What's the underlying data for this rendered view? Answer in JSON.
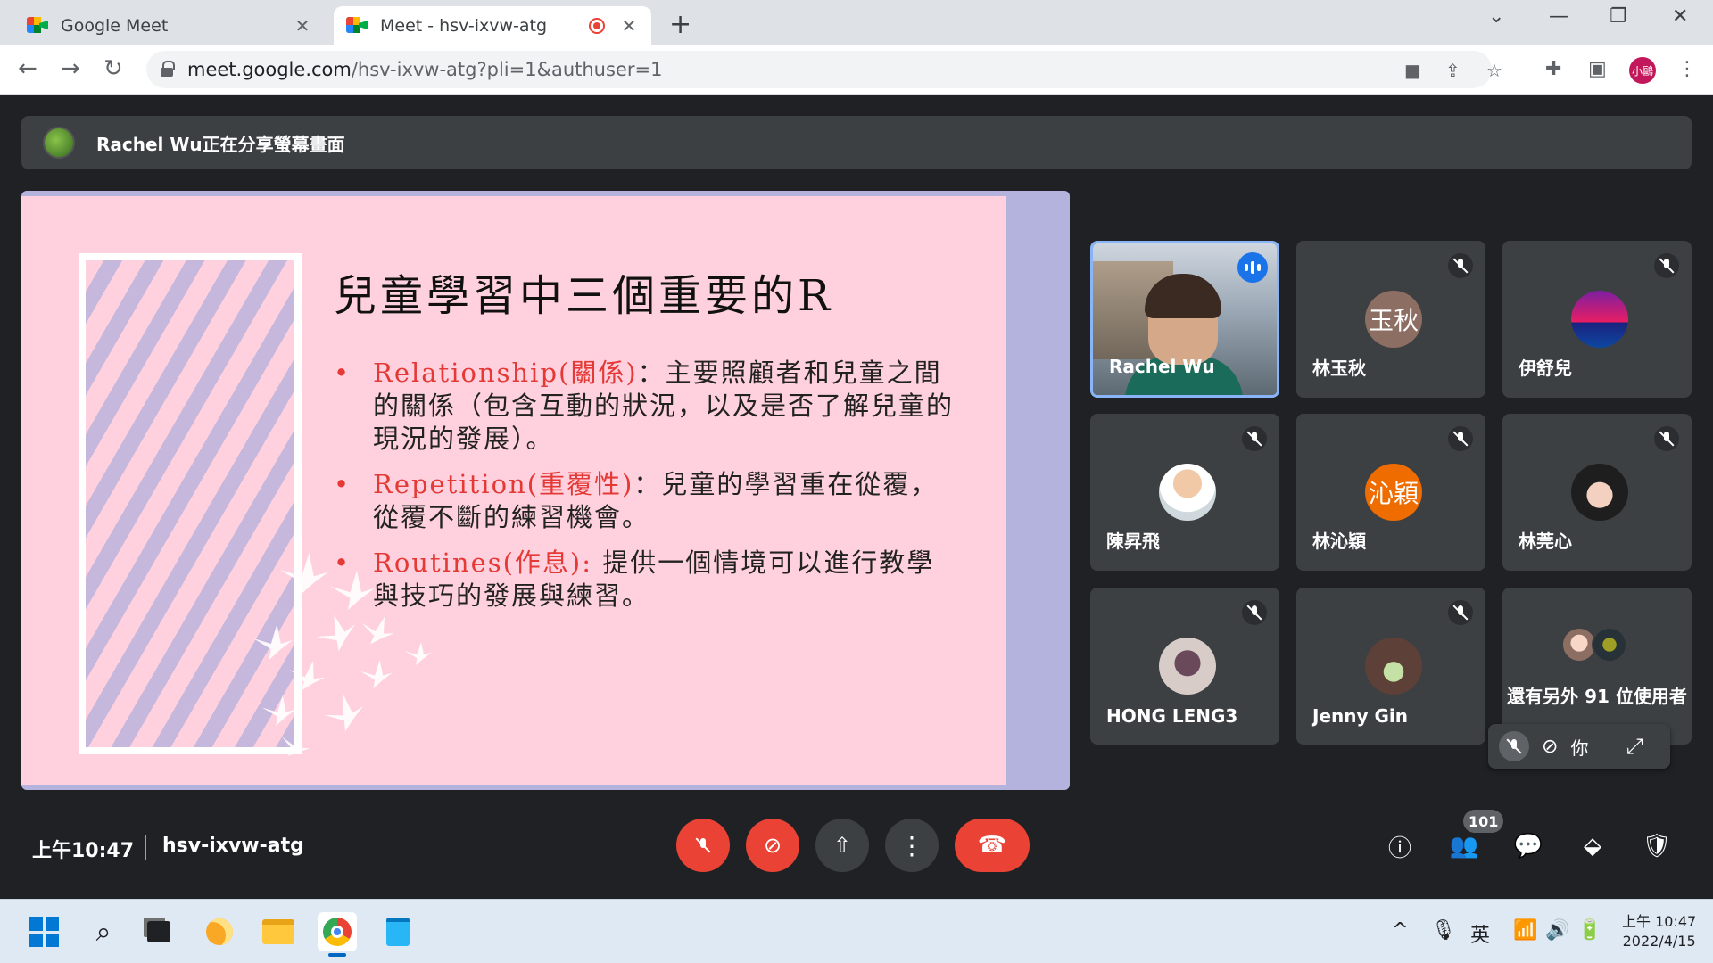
{
  "browser": {
    "tabs": [
      {
        "label": "Google Meet",
        "active": false
      },
      {
        "label": "Meet - hsv-ixvw-atg",
        "active": true
      }
    ],
    "url_host": "meet.google.com",
    "url_path": "/hsv-ixvw-atg?pli=1&authuser=1",
    "profile_initials": "小鷗"
  },
  "banner": {
    "text": "Rachel Wu正在分享螢幕畫面"
  },
  "slide": {
    "title": "兒童學習中三個重要的R",
    "bullets": [
      {
        "term": "Relationship(關係)",
        "text": "：主要照顧者和兒童之間的關係（包含互動的狀況，以及是否了解兒童的現況的發展）。"
      },
      {
        "term": "Repetition(重覆性)",
        "text": "：兒童的學習重在從覆，從覆不斷的練習機會。"
      },
      {
        "term": "Routines(作息):",
        "text": " 提供一個情境可以進行教學與技巧的發展與練習。"
      }
    ]
  },
  "participants": [
    {
      "name": "Rachel Wu",
      "speaking": true
    },
    {
      "name": "林玉秋",
      "avatar_text": "玉秋",
      "avatar_color": "#8d6e63"
    },
    {
      "name": "伊舒兒",
      "avatar_text": "",
      "avatar_color": "#ab47bc"
    },
    {
      "name": "陳昇飛",
      "avatar_text": "",
      "avatar_color": "#e0e0e0"
    },
    {
      "name": "林沁穎",
      "avatar_text": "沁穎",
      "avatar_color": "#ef6c00"
    },
    {
      "name": "林莞心",
      "avatar_text": "",
      "avatar_color": "#424242"
    },
    {
      "name": "HONG LENG3",
      "avatar_text": "",
      "avatar_color": "#bdbdbd"
    },
    {
      "name": "Jenny Gin",
      "avatar_text": "",
      "avatar_color": "#6d4c41"
    }
  ],
  "others": {
    "label": "還有另外 91 位使用者"
  },
  "self_view": {
    "label": "你"
  },
  "controls": {
    "time": "上午10:47",
    "meeting_code": "hsv-ixvw-atg",
    "participant_count": "101"
  },
  "taskbar": {
    "ime": "英",
    "time": "上午 10:47",
    "date": "2022/4/15"
  },
  "colors": {
    "meet_bg": "#202124",
    "tile_bg": "#3c4043",
    "danger": "#ea4335",
    "slide_bg": "#ffd1df",
    "slide_accent": "#e53935"
  }
}
